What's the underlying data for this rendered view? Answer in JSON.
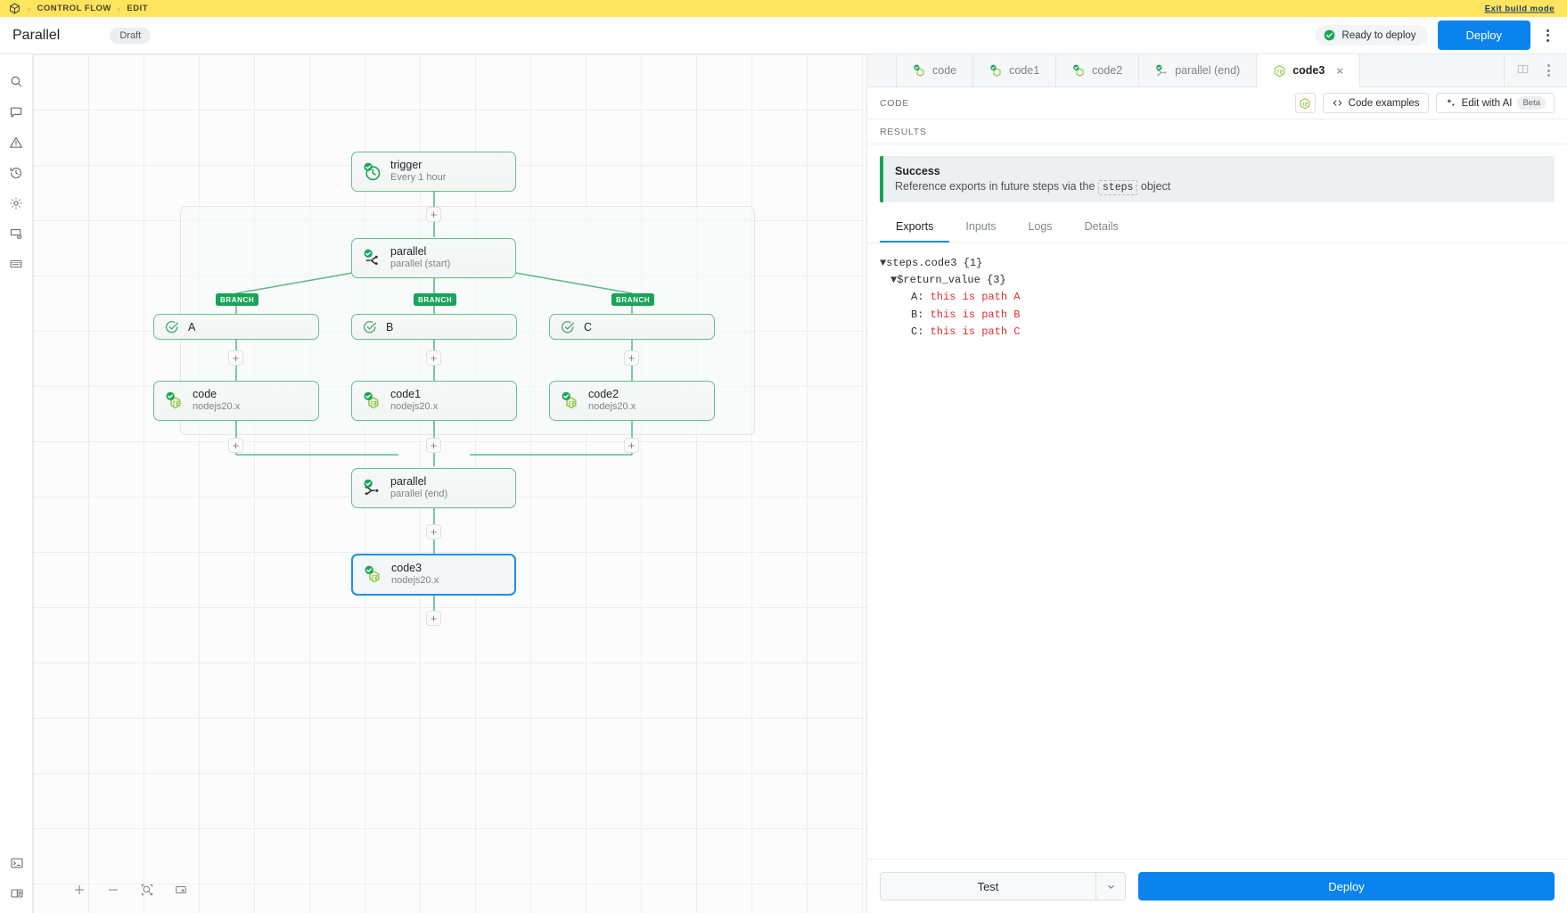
{
  "buildbar": {
    "logo_icon": "cube-icon",
    "crumb1": "CONTROL FLOW",
    "crumb2": "EDIT",
    "exit_label": "Exit build mode"
  },
  "titlebar": {
    "title": "Parallel",
    "status_chip": "Draft",
    "ready_label": "Ready to deploy",
    "deploy_label": "Deploy",
    "menu_icon": "kebab-menu-icon"
  },
  "rail": {
    "items": [
      {
        "icon": "search-icon",
        "name": "search"
      },
      {
        "icon": "chat-icon",
        "name": "chat"
      },
      {
        "icon": "warning-icon",
        "name": "warnings"
      },
      {
        "icon": "history-icon",
        "name": "history"
      },
      {
        "icon": "gear-icon",
        "name": "settings"
      },
      {
        "icon": "window-settings-icon",
        "name": "project-settings"
      },
      {
        "icon": "keyboard-icon",
        "name": "shortcuts"
      }
    ],
    "bottom": [
      {
        "icon": "terminal-icon",
        "name": "terminal"
      },
      {
        "icon": "panel-toggle-icon",
        "name": "toggle-panel"
      }
    ]
  },
  "canvas": {
    "zoom_tools": [
      {
        "icon": "plus-icon",
        "name": "zoom-in"
      },
      {
        "icon": "minus-icon",
        "name": "zoom-out"
      },
      {
        "icon": "fit-view-icon",
        "name": "fit-view"
      },
      {
        "icon": "minimap-icon",
        "name": "minimap"
      }
    ],
    "branch_tag": "BRANCH",
    "plus_glyph": "+",
    "nodes": {
      "trigger": {
        "name": "trigger",
        "sub": "Every 1 hour",
        "icon": "clock-check-icon"
      },
      "parallel_start": {
        "name": "parallel",
        "sub": "parallel (start)",
        "icon": "parallel-start-icon"
      },
      "branch_a": {
        "name": "A",
        "icon": "condition-check-icon"
      },
      "branch_b": {
        "name": "B",
        "icon": "condition-check-icon"
      },
      "branch_c": {
        "name": "C",
        "icon": "condition-check-icon"
      },
      "code": {
        "name": "code",
        "sub": "nodejs20.x",
        "icon": "nodejs-check-icon"
      },
      "code1": {
        "name": "code1",
        "sub": "nodejs20.x",
        "icon": "nodejs-check-icon"
      },
      "code2": {
        "name": "code2",
        "sub": "nodejs20.x",
        "icon": "nodejs-check-icon"
      },
      "parallel_end": {
        "name": "parallel",
        "sub": "parallel (end)",
        "icon": "parallel-end-icon"
      },
      "code3": {
        "name": "code3",
        "sub": "nodejs20.x",
        "icon": "nodejs-check-icon"
      }
    }
  },
  "rpanel": {
    "tabs": [
      {
        "label": "code",
        "icon": "nodejs-check-icon",
        "active": false,
        "closable": false
      },
      {
        "label": "code1",
        "icon": "nodejs-check-icon",
        "active": false,
        "closable": false
      },
      {
        "label": "code2",
        "icon": "nodejs-check-icon",
        "active": false,
        "closable": false
      },
      {
        "label": "parallel (end)",
        "icon": "parallel-end-icon",
        "active": false,
        "closable": false
      },
      {
        "label": "code3",
        "icon": "nodejs-icon",
        "active": true,
        "closable": true
      }
    ],
    "tab_close_glyph": "×",
    "tail_icons": [
      {
        "icon": "split-pane-icon",
        "name": "split-pane"
      },
      {
        "icon": "kebab-menu-icon",
        "name": "panel-menu"
      }
    ],
    "code_label": "CODE",
    "lang_icon": "nodejs-icon",
    "code_examples_label": "Code examples",
    "code_examples_icon": "code-brackets-icon",
    "edit_ai_label": "Edit with AI",
    "edit_ai_icon": "sparkle-icon",
    "edit_ai_beta": "Beta",
    "results_label": "RESULTS",
    "success": {
      "title": "Success",
      "desc_before": "Reference exports in future steps via the ",
      "code_chip": "steps",
      "desc_after": " object"
    },
    "subtabs": [
      {
        "label": "Exports",
        "active": true
      },
      {
        "label": "Inputs",
        "active": false
      },
      {
        "label": "Logs",
        "active": false
      },
      {
        "label": "Details",
        "active": false
      }
    ],
    "exports_tree": [
      {
        "indent": 0,
        "caret": "▼",
        "key": "steps.code3 {1}",
        "value": ""
      },
      {
        "indent": 1,
        "caret": "▼",
        "key": "$return_value {3}",
        "value": ""
      },
      {
        "indent": 2,
        "caret": "",
        "key": "A:",
        "value": "this is path A"
      },
      {
        "indent": 2,
        "caret": "",
        "key": "B:",
        "value": "this is path B"
      },
      {
        "indent": 2,
        "caret": "",
        "key": "C:",
        "value": "this is path C"
      }
    ],
    "footer": {
      "test_label": "Test",
      "test_caret_icon": "chevron-down-icon",
      "deploy_label": "Deploy"
    }
  },
  "colors": {
    "build_yellow": "#ffe45e",
    "accent_blue": "#0a84ec",
    "node_green": "#69bf8f",
    "branch_green": "#18a558",
    "value_red": "#e03030"
  }
}
